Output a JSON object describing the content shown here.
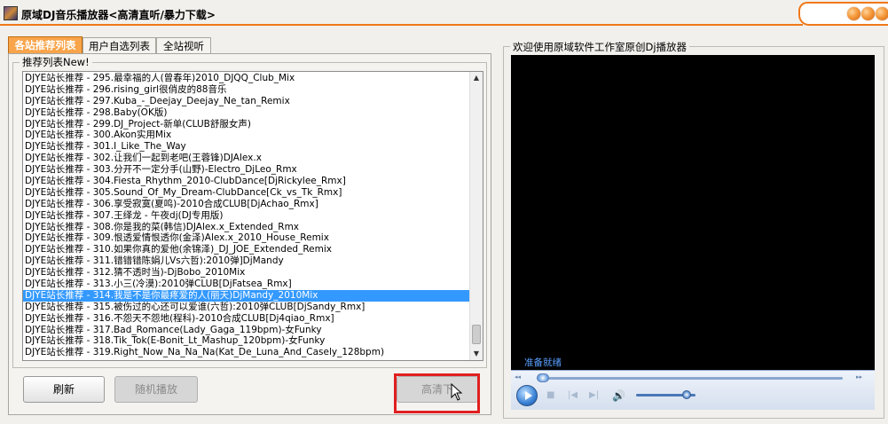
{
  "window": {
    "title": "原域DJ音乐播放器<高清直听/暴力下载>",
    "accent": "#f07818"
  },
  "tabs": [
    "各站推荐列表",
    "用户自选列表",
    "全站视听"
  ],
  "list_group_label": "推荐列表New!",
  "playlist": [
    "DJYE站长推荐 - 295.最幸福的人(曾春年)2010_DJQQ_Club_Mix",
    "DJYE站长推荐 - 296.rising_girl很俏皮的88音乐",
    "DJYE站长推荐 - 297.Kuba_-_Deejay_Deejay_Ne_tan_Remix",
    "DJYE站长推荐 - 298.Baby(OK版)",
    "DJYE站长推荐 - 299.DJ_Project-新单(CLUB舒服女声)",
    "DJYE站长推荐 - 300.Akon实用Mix",
    "DJYE站长推荐 - 301.I_Like_The_Way",
    "DJYE站长推荐 - 302.让我们一起到老吧(王蓉锋)DJAlex.x",
    "DJYE站长推荐 - 303.分开不一定分手(山野)-Electro_DjLeo_Rmx",
    "DJYE站长推荐 - 304.Fiesta_Rhythm_2010-ClubDance[DjRickylee_Rmx]",
    "DJYE站长推荐 - 305.Sound_Of_My_Dream-ClubDance[Ck_vs_Tk_Rmx]",
    "DJYE站长推荐 - 306.享受寂寞(夏鸣)-2010合成CLUB[DjAchao_Rmx]",
    "DJYE站长推荐 - 307.王绎龙 - 午夜dj(DJ专用版)",
    "DJYE站长推荐 - 308.你是我的菜(韩信)DJAlex.x_Extended_Rmx",
    "DJYE站长推荐 - 309.恨透爱情恨透你(金泽)Alex.x_2010_House_Remix",
    "DJYE站长推荐 - 310.如果你真的爱他(余锦泽)_DJ_JOE_Extended_Remix",
    "DJYE站长推荐 - 311.错错错陈娟儿Vs六哲):2010弹]DjMandy",
    "DJYE站长推荐 - 312.猜不透时当)-DjBobo_2010Mix",
    "DJYE站长推荐 - 313.小三(冷漠):2010弹CLUB[DjFatsea_Rmx]",
    "DJYE站长推荐 - 314.我是不是你最疼爱的人(丽天)DjMandy_2010Mix",
    "DJYE站长推荐 - 315.被伤过的心还可以爱谁(六哲):2010弹CLUB[DjSandy_Rmx]",
    "DJYE站长推荐 - 316.不怨天不怨地(程科)-2010合成CLUB[Dj4qiao_Rmx]",
    "DJYE站长推荐 - 317.Bad_Romance(Lady_Gaga_119bpm)-女Funky",
    "DJYE站长推荐 - 318.Tik_Tok(E-Bonit_Lt_Mashup_120bpm)-女Funky",
    "DJYE站长推荐 - 319.Right_Now_Na_Na_Na(Kat_De_Luna_And_Casely_128bpm)"
  ],
  "selected_index": 19,
  "buttons": {
    "refresh": "刷新",
    "random": "随机播放",
    "download": "高清下"
  },
  "player": {
    "group_label": "欢迎使用原域软件工作室原创Dj播放器",
    "status": "准备就绪",
    "seek_left": "◂◂",
    "seek_right": "▸▸",
    "play_icon": "play-icon",
    "volume_level": 0.85
  }
}
